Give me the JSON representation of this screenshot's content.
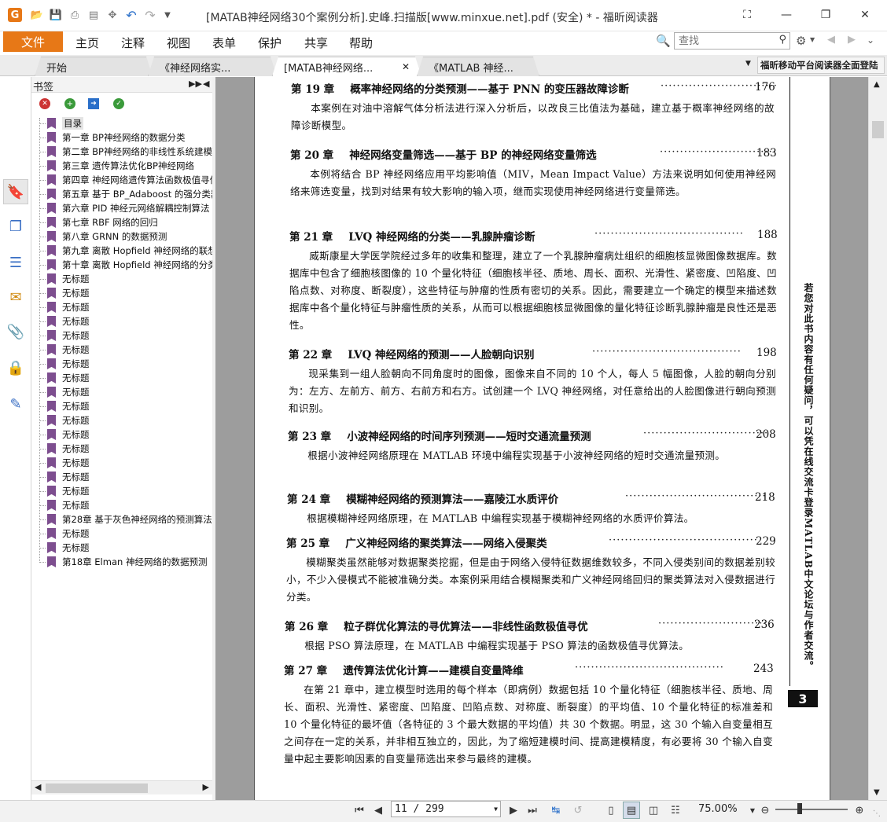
{
  "window": {
    "title": "[MATAB神经网络30个案例分析].史峰.扫描版[www.minxue.net].pdf (安全) * - 福昕阅读器",
    "accent": "#e77817"
  },
  "quick_access": [
    "app-logo-icon",
    "open-icon",
    "save-icon",
    "print-icon",
    "scan-icon",
    "new-icon",
    "undo-icon",
    "redo-icon",
    "more-icon"
  ],
  "menu": {
    "file": "文件",
    "items": [
      "主页",
      "注释",
      "视图",
      "表单",
      "保护",
      "共享",
      "帮助"
    ],
    "search_placeholder": "查找"
  },
  "tabs": [
    {
      "label": "开始"
    },
    {
      "label": "《神经网络实..."
    },
    {
      "label": "[MATAB神经网络..."
    },
    {
      "label": "《MATLAB 神经..."
    }
  ],
  "promo": "福昕移动平台阅读器全面登陆",
  "bookmarks": {
    "title": "书签",
    "items": [
      "目录",
      "第一章 BP神经网络的数据分类",
      "第二章 BP神经网络的非线性系统建模",
      "第三章 遗传算法优化BP神经网络",
      "第四章 神经网络遗传算法函数极值寻优",
      "第五章 基于 BP_Adaboost 的强分类器设计",
      "第六章 PID 神经元网络解耦控制算法",
      "第七章 RBF 网络的回归",
      "第八章 GRNN 的数据预测",
      "第九章 离散 Hopfield 神经网络的联想记忆",
      "第十章 离散 Hopfield 神经网络的分类",
      "无标题",
      "无标题",
      "无标题",
      "无标题",
      "无标题",
      "无标题",
      "无标题",
      "无标题",
      "无标题",
      "无标题",
      "无标题",
      "无标题",
      "无标题",
      "无标题",
      "无标题",
      "无标题",
      "无标题",
      "第28章 基于灰色神经网络的预测算法",
      "无标题",
      "无标题",
      "第18章 Elman 神经网络的数据预测"
    ]
  },
  "document": {
    "entries": [
      {
        "chapter": "第 19 章",
        "title": "概率神经网络的分类预测——基于 PNN 的变压器故障诊断",
        "page": "176",
        "desc": "本案例在对油中溶解气体分析法进行深入分析后，以改良三比值法为基础，建立基于概率神经网络的故障诊断模型。"
      },
      {
        "chapter": "第 20 章",
        "title": "神经网络变量筛选——基于 BP 的神经网络变量筛选",
        "page": "183",
        "desc": "本例将结合 BP 神经网络应用平均影响值（MIV，Mean Impact Value）方法来说明如何使用神经网络来筛选变量，找到对结果有较大影响的输入项，继而实现使用神经网络进行变量筛选。"
      },
      {
        "chapter": "第 21 章",
        "title": "LVQ 神经网络的分类——乳腺肿瘤诊断",
        "page": "188",
        "desc": "威斯康星大学医学院经过多年的收集和整理，建立了一个乳腺肿瘤病灶组织的细胞核显微图像数据库。数据库中包含了细胞核图像的 10 个量化特征（细胞核半径、质地、周长、面积、光滑性、紧密度、凹陷度、凹陷点数、对称度、断裂度），这些特征与肿瘤的性质有密切的关系。因此，需要建立一个确定的模型来描述数据库中各个量化特征与肿瘤性质的关系，从而可以根据细胞核显微图像的量化特征诊断乳腺肿瘤是良性还是恶性。"
      },
      {
        "chapter": "第 22 章",
        "title": "LVQ 神经网络的预测——人脸朝向识别",
        "page": "198",
        "desc": "现采集到一组人脸朝向不同角度时的图像，图像来自不同的 10 个人，每人 5 幅图像，人脸的朝向分别为：左方、左前方、前方、右前方和右方。试创建一个 LVQ 神经网络，对任意给出的人脸图像进行朝向预测和识别。"
      },
      {
        "chapter": "第 23 章",
        "title": "小波神经网络的时间序列预测——短时交通流量预测",
        "page": "208",
        "desc": "根据小波神经网络原理在 MATLAB 环境中编程实现基于小波神经网络的短时交通流量预测。"
      },
      {
        "chapter": "第 24 章",
        "title": "模糊神经网络的预测算法——嘉陵江水质评价",
        "page": "218",
        "desc": "根据模糊神经网络原理，在 MATLAB 中编程实现基于模糊神经网络的水质评价算法。"
      },
      {
        "chapter": "第 25 章",
        "title": "广义神经网络的聚类算法——网络入侵聚类",
        "page": "229",
        "desc": "模糊聚类虽然能够对数据聚类挖掘，但是由于网络入侵特征数据维数较多，不同入侵类别间的数据差别较小，不少入侵模式不能被准确分类。本案例采用结合模糊聚类和广义神经网络回归的聚类算法对入侵数据进行分类。"
      },
      {
        "chapter": "第 26 章",
        "title": "粒子群优化算法的寻优算法——非线性函数极值寻优",
        "page": "236",
        "desc": "根据 PSO 算法原理，在 MATLAB 中编程实现基于 PSO 算法的函数极值寻优算法。"
      },
      {
        "chapter": "第 27 章",
        "title": "遗传算法优化计算——建模自变量降维",
        "page": "243",
        "desc": "在第 21 章中，建立模型时选用的每个样本（即病例）数据包括 10 个量化特征（细胞核半径、质地、周长、面积、光滑性、紧密度、凹陷度、凹陷点数、对称度、断裂度）的平均值、10 个量化特征的标准差和 10 个量化特征的最坏值（各特征的 3 个最大数据的平均值）共 30 个数据。明显，这 30 个输入自变量相互之间存在一定的关系，并非相互独立的，因此，为了缩短建模时间、提高建模精度，有必要将 30 个输入自变量中起主要影响因素的自变量筛选出来参与最终的建模。"
      }
    ],
    "side_note": "若您对此书内容有任何疑问，可以凭在线交流卡登录MATLAB中文论坛与作者交流。",
    "page_badge": "3"
  },
  "status": {
    "page_display": "11 / 299",
    "zoom": "75.00%"
  }
}
